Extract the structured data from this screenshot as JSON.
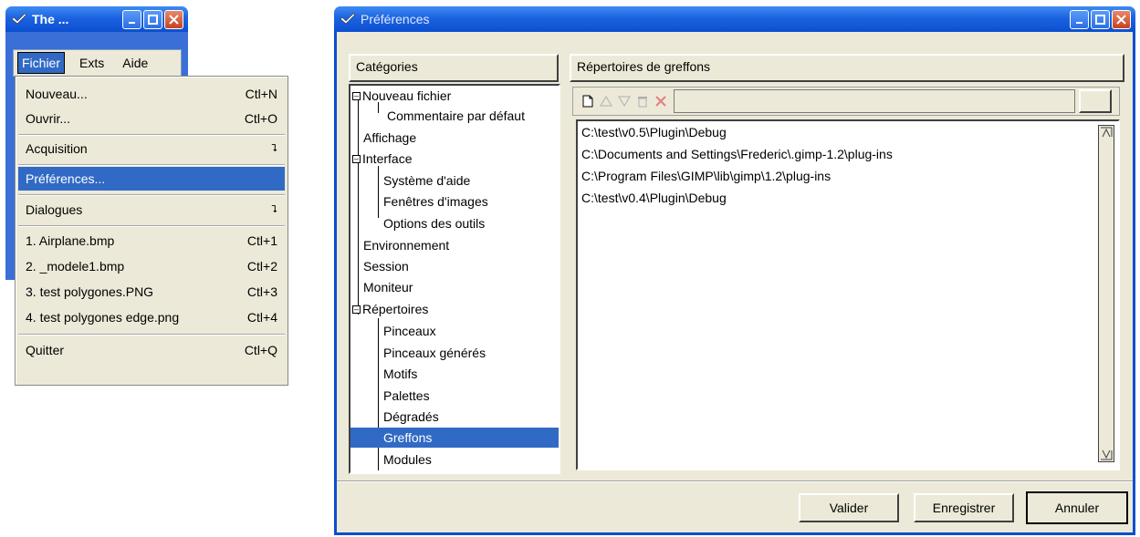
{
  "small_window": {
    "title": "The ...",
    "menus": [
      "Fichier",
      "Exts",
      "Aide"
    ]
  },
  "file_menu": {
    "items": [
      {
        "label": "Nouveau...",
        "shortcut": "Ctl+N"
      },
      {
        "label": "Ouvrir...",
        "shortcut": "Ctl+O"
      },
      {
        "label": "Acquisition",
        "shortcut": ""
      },
      {
        "label": "Préférences...",
        "shortcut": ""
      },
      {
        "label": "Dialogues",
        "shortcut": ""
      },
      {
        "label": "1. Airplane.bmp",
        "shortcut": "Ctl+1"
      },
      {
        "label": "2. _modele1.bmp",
        "shortcut": "Ctl+2"
      },
      {
        "label": "3. test polygones.PNG",
        "shortcut": "Ctl+3"
      },
      {
        "label": "4. test polygones edge.png",
        "shortcut": "Ctl+4"
      },
      {
        "label": "Quitter",
        "shortcut": "Ctl+Q"
      }
    ]
  },
  "prefs": {
    "title": "Préférences",
    "categories_header": "Catégories",
    "categories": [
      "Nouveau fichier",
      "Commentaire par défaut",
      "Affichage",
      "Interface",
      "Système d'aide",
      "Fenêtres d'images",
      "Options des outils",
      "Environnement",
      "Session",
      "Moniteur",
      "Répertoires",
      "Pinceaux",
      "Pinceaux générés",
      "Motifs",
      "Palettes",
      "Dégradés",
      "Greffons",
      "Modules"
    ],
    "selected_category": "Greffons",
    "content_header": "Répertoires de greffons",
    "path_input": "",
    "paths": [
      "C:\\test\\v0.5\\Plugin\\Debug",
      "C:\\Documents and Settings\\Frederic\\.gimp-1.2\\plug-ins",
      "C:\\Program Files\\GIMP\\lib\\gimp\\1.2\\plug-ins",
      "C:\\test\\v0.4\\Plugin\\Debug"
    ],
    "buttons": {
      "ok": "Valider",
      "save": "Enregistrer",
      "cancel": "Annuler"
    }
  },
  "colors": {
    "titlebar": "#0b4fd0",
    "selection": "#316ac5",
    "dialog_bg": "#ece9d8"
  }
}
